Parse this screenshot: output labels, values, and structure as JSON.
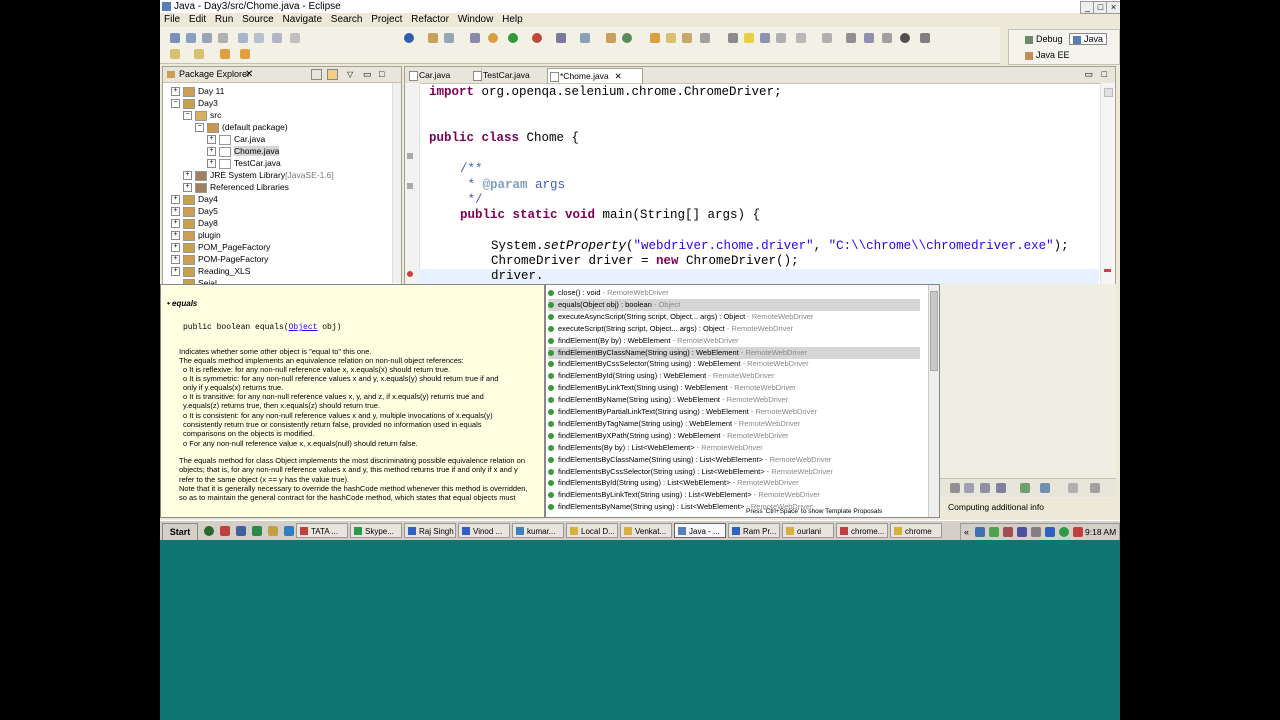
{
  "window": {
    "title": "Java - Day3/src/Chome.java - Eclipse",
    "minimize": "_",
    "maximize": "□",
    "close": "×"
  },
  "menu": [
    "File",
    "Edit",
    "Run",
    "Source",
    "Navigate",
    "Search",
    "Project",
    "Refactor",
    "Window",
    "Help"
  ],
  "perspectives": {
    "debug": "Debug",
    "java": "Java",
    "javaee": "Java EE"
  },
  "package_explorer": {
    "title": "Package Explorer",
    "items": [
      {
        "label": "Day 11",
        "exp": "+"
      },
      {
        "label": "Day3",
        "exp": "−"
      },
      {
        "label": "src",
        "exp": "−"
      },
      {
        "label": "(default package)",
        "exp": "−"
      },
      {
        "label": "Car.java",
        "exp": "+"
      },
      {
        "label": "Chome.java",
        "exp": "+"
      },
      {
        "label": "TestCar.java",
        "exp": "+"
      },
      {
        "label": "JRE System Library",
        "suffix": "[JavaSE-1.6]",
        "exp": "+"
      },
      {
        "label": "Referenced Libraries",
        "exp": "+"
      },
      {
        "label": "Day4",
        "exp": "+"
      },
      {
        "label": "Day5",
        "exp": "+"
      },
      {
        "label": "Day8",
        "exp": "+"
      },
      {
        "label": "plugin",
        "exp": "+"
      },
      {
        "label": "POM_PageFactory",
        "exp": "+"
      },
      {
        "label": "POM-PageFactory",
        "exp": "+"
      },
      {
        "label": "Reading_XLS",
        "exp": "+"
      },
      {
        "label": "Sejal",
        "exp": ""
      }
    ]
  },
  "editor": {
    "tabs": [
      "Car.java",
      "TestCar.java",
      "*Chome.java"
    ],
    "lines": {
      "l1_kw": "import",
      "l1_rest": " org.openqa.selenium.chrome.ChromeDriver;",
      "l2_kw": "public class",
      "l2_rest": " Chome {",
      "l3": "/**",
      "l4_pre": " * ",
      "l4_tag": "@param",
      "l4_rest": " args",
      "l5": " */",
      "l6_kw": "public static void",
      "l6_rest": " main(String[] args) {",
      "l7_a": "System.",
      "l7_b": "setProperty",
      "l7_c": "(",
      "l7_s1": "\"webdriver.chome.driver\"",
      "l7_d": ", ",
      "l7_s2": "\"C:\\\\chrome\\\\chromedriver.exe\"",
      "l7_e": ");",
      "l8_a": "ChromeDriver driver = ",
      "l8_kw": "new",
      "l8_b": " ChromeDriver();",
      "l9": "driver."
    }
  },
  "javadoc": {
    "method_name": "equals",
    "signature_pre": "public boolean equals(",
    "signature_link": "Object",
    "signature_post": " obj)",
    "lines": [
      "Indicates whether some other object is \"equal to\" this one.",
      "The equals method implements an equivalence relation on non-null object references:",
      "o  It is reflexive: for any non-null reference value x, x.equals(x) should return true.",
      "o  It is symmetric: for any non-null reference values x and y, x.equals(y) should return true if and",
      "    only if y.equals(x) returns true.",
      "o  It is transitive: for any non-null reference values x, y, and z, if x.equals(y) returns true and",
      "    y.equals(z) returns true, then x.equals(z) should return true.",
      "o  It is consistent: for any non-null reference values x and y, multiple invocations of x.equals(y)",
      "    consistently return true or consistently return false, provided no information used in equals",
      "    comparisons on the objects is modified.",
      "o  For any non-null reference value x, x.equals(null) should return false.",
      "The equals method for class Object implements the most discriminating possible equivalence relation on",
      "objects; that is, for any non-null reference values x and y, this method returns true if and only if x and y",
      "refer to the same object (x == y has the value true).",
      "Note that it is generally necessary to override the hashCode method whenever this method is overridden,",
      "so as to maintain the general contract for the hashCode method, which states that equal objects must"
    ]
  },
  "completions": [
    {
      "sig": "close() : void",
      "cls": " - RemoteWebDriver"
    },
    {
      "sig": "equals(Object obj) : boolean",
      "cls": " - Object"
    },
    {
      "sig": "executeAsyncScript(String script, Object... args) : Object",
      "cls": " - RemoteWebDriver"
    },
    {
      "sig": "executeScript(String script, Object... args) : Object",
      "cls": " - RemoteWebDriver"
    },
    {
      "sig": "findElement(By by) : WebElement",
      "cls": " - RemoteWebDriver"
    },
    {
      "sig": "findElementByClassName(String using) : WebElement",
      "cls": " - RemoteWebDriver"
    },
    {
      "sig": "findElementByCssSelector(String using) : WebElement",
      "cls": " - RemoteWebDriver"
    },
    {
      "sig": "findElementById(String using) : WebElement",
      "cls": " - RemoteWebDriver"
    },
    {
      "sig": "findElementByLinkText(String using) : WebElement",
      "cls": " - RemoteWebDriver"
    },
    {
      "sig": "findElementByName(String using) : WebElement",
      "cls": " - RemoteWebDriver"
    },
    {
      "sig": "findElementByPartialLinkText(String using) : WebElement",
      "cls": " - RemoteWebDriver"
    },
    {
      "sig": "findElementByTagName(String using) : WebElement",
      "cls": " - RemoteWebDriver"
    },
    {
      "sig": "findElementByXPath(String using) : WebElement",
      "cls": " - RemoteWebDriver"
    },
    {
      "sig": "findElements(By by) : List<WebElement>",
      "cls": " - RemoteWebDriver"
    },
    {
      "sig": "findElementsByClassName(String using) : List<WebElement>",
      "cls": " - RemoteWebDriver"
    },
    {
      "sig": "findElementsByCssSelector(String using) : List<WebElement>",
      "cls": " - RemoteWebDriver"
    },
    {
      "sig": "findElementsById(String using) : List<WebElement>",
      "cls": " - RemoteWebDriver"
    },
    {
      "sig": "findElementsByLinkText(String using) : List<WebElement>",
      "cls": " - RemoteWebDriver"
    },
    {
      "sig": "findElementsByName(String using) : List<WebElement>",
      "cls": " - RemoteWebDriver"
    }
  ],
  "completion_hint": "Press 'Ctrl+Space' to show Template Proposals",
  "status": "Computing additional info",
  "taskbar": {
    "start": "Start",
    "tasks": [
      "TATA ...",
      "Skype...",
      "Raj Singh",
      "Vinod ...",
      "kumar...",
      "Local D...",
      "Venkat...",
      "Java - ...",
      "Ram Pr...",
      "ourlani",
      "chrome...",
      "chrome"
    ],
    "clock": "9:18 AM"
  },
  "colors": {
    "keyword": "#7f0055",
    "string": "#2a00ff",
    "comment": "#3f5fbf",
    "desktop": "#0e7570",
    "javadoc_bg": "#ffffe1"
  }
}
